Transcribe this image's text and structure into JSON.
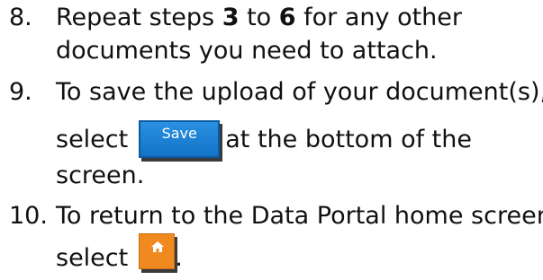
{
  "steps": [
    {
      "number": "8.",
      "line1_pre": "Repeat steps ",
      "bold_a": "3",
      "line1_mid": " to ",
      "bold_b": "6",
      "line1_post": " for any other",
      "line2": "documents you need to attach."
    },
    {
      "number": "9.",
      "line1": "To save the upload of your document(s),",
      "line2_pre": "select",
      "button_label": "Save",
      "line2_post": "at the bottom of the",
      "line3": "screen."
    },
    {
      "number": "10.",
      "line1": "To return to the Data Portal home screen,",
      "line2_pre": "select",
      "icon": "home-icon",
      "line2_post": "."
    }
  ],
  "colors": {
    "save_button": "#1b7fd6",
    "home_button": "#f08a20"
  }
}
